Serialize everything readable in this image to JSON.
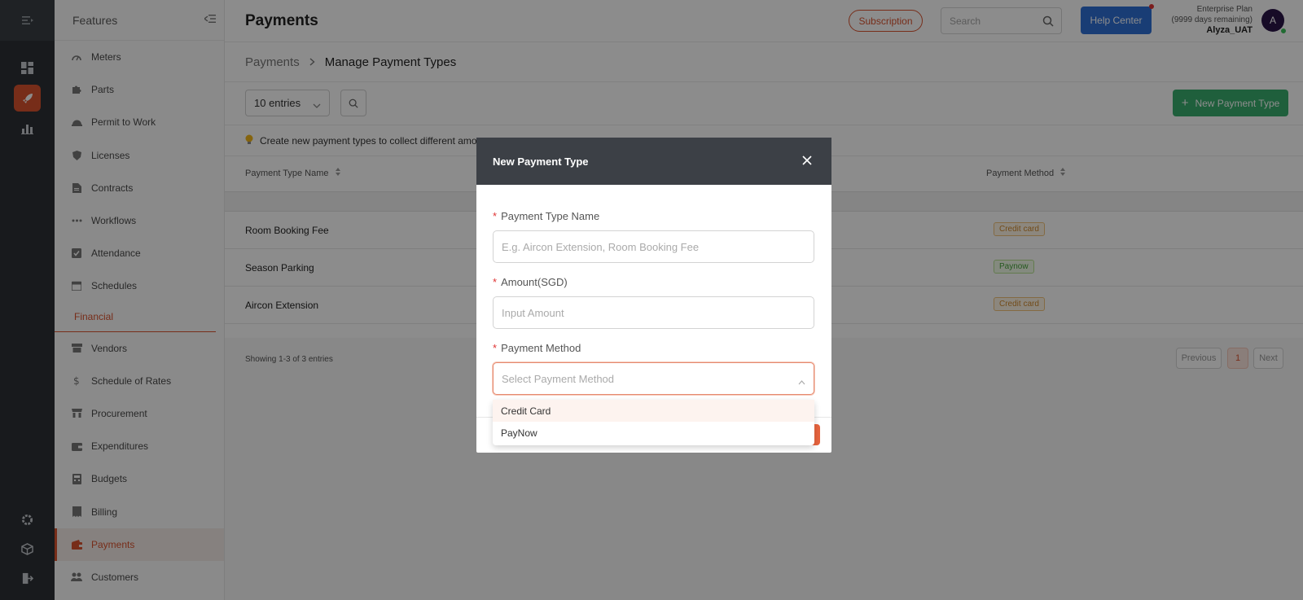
{
  "header": {
    "title": "Payments",
    "subscription_label": "Subscription",
    "search_placeholder": "Search",
    "help_label": "Help Center",
    "plan_name": "Enterprise Plan",
    "plan_days": "(9999 days remaining)",
    "username": "Alyza_UAT",
    "avatar_initial": "A"
  },
  "sidebar": {
    "title": "Features",
    "items_top": [
      {
        "label": "Meters",
        "icon": "gauge-icon"
      },
      {
        "label": "Parts",
        "icon": "puzzle-icon"
      },
      {
        "label": "Permit to Work",
        "icon": "helmet-icon"
      },
      {
        "label": "Licenses",
        "icon": "shield-icon"
      },
      {
        "label": "Contracts",
        "icon": "contract-icon"
      },
      {
        "label": "Workflows",
        "icon": "dots-icon"
      },
      {
        "label": "Attendance",
        "icon": "check-square-icon"
      },
      {
        "label": "Schedules",
        "icon": "calendar-icon"
      }
    ],
    "section_label": "Financial",
    "items_fin": [
      {
        "label": "Vendors",
        "icon": "store-icon"
      },
      {
        "label": "Schedule of Rates",
        "icon": "dollar-icon"
      },
      {
        "label": "Procurement",
        "icon": "shop-icon"
      },
      {
        "label": "Expenditures",
        "icon": "wallet-icon"
      },
      {
        "label": "Budgets",
        "icon": "calculator-icon"
      },
      {
        "label": "Billing",
        "icon": "receipt-icon"
      },
      {
        "label": "Payments",
        "icon": "payment-icon"
      },
      {
        "label": "Customers",
        "icon": "people-icon"
      }
    ]
  },
  "breadcrumb": {
    "parent": "Payments",
    "current": "Manage Payment Types"
  },
  "toolbar": {
    "entries_label": "10 entries",
    "new_button_label": "New Payment Type"
  },
  "info_text": "Create new payment types to collect different amo",
  "table": {
    "col_name": "Payment Type Name",
    "col_method": "Payment Method",
    "rows": [
      {
        "name": "Room Booking Fee",
        "method": "Credit card",
        "method_kind": "cc"
      },
      {
        "name": "Season Parking",
        "method": "Paynow",
        "method_kind": "pn"
      },
      {
        "name": "Aircon Extension",
        "method": "Credit card",
        "method_kind": "cc"
      }
    ],
    "showing": "Showing 1-3 of 3 entries",
    "prev_label": "Previous",
    "page_num": "1",
    "next_label": "Next"
  },
  "modal": {
    "title": "New Payment Type",
    "name_label": "Payment Type Name",
    "name_placeholder": "E.g. Aircon Extension, Room Booking Fee",
    "amount_label": "Amount(SGD)",
    "amount_placeholder": "Input Amount",
    "method_label": "Payment Method",
    "method_placeholder": "Select Payment Method",
    "options": [
      "Credit Card",
      "PayNow"
    ]
  },
  "colors": {
    "accent": "#d9532f",
    "help_blue": "#2f6fd6",
    "new_green": "#3aae6e",
    "rail_dark": "#2c3036"
  }
}
